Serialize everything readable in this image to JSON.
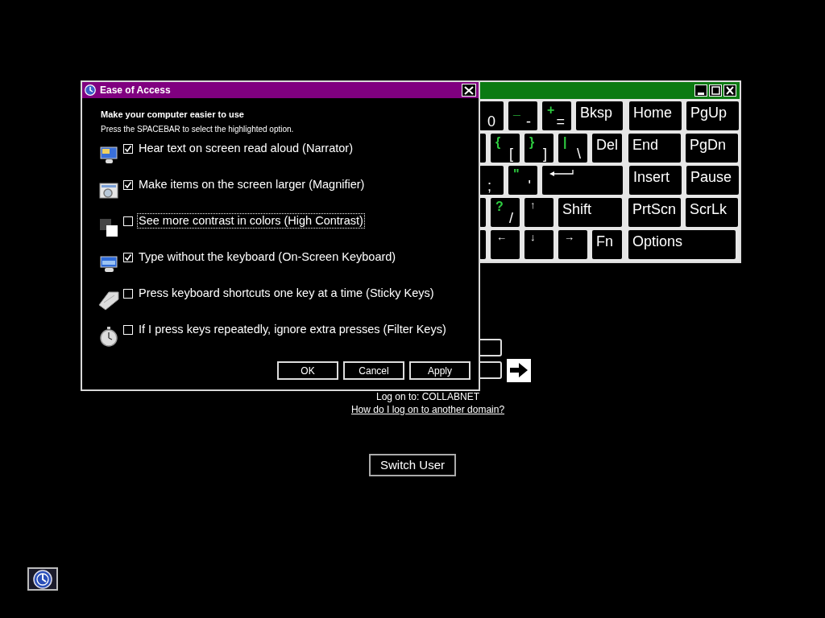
{
  "keyboard": {
    "rows": [
      {
        "keys": [
          {
            "kind": "partial",
            "main": "0"
          },
          {
            "kind": "char",
            "shift": "_",
            "main": "-"
          },
          {
            "kind": "char",
            "shift": "+",
            "main": "="
          },
          {
            "kind": "label",
            "main": "Bksp"
          },
          {
            "kind": "label",
            "main": "Home"
          },
          {
            "kind": "label",
            "main": "PgUp"
          }
        ]
      },
      {
        "keys": [
          {
            "kind": "partial"
          },
          {
            "kind": "char",
            "shift": "{",
            "main": "["
          },
          {
            "kind": "char",
            "shift": "}",
            "main": "]"
          },
          {
            "kind": "char",
            "shift": "|",
            "main": "\\"
          },
          {
            "kind": "label",
            "main": "Del"
          },
          {
            "kind": "label",
            "main": "End"
          },
          {
            "kind": "label",
            "main": "PgDn"
          }
        ]
      },
      {
        "keys": [
          {
            "kind": "partial",
            "main": ";"
          },
          {
            "kind": "char",
            "shift": "\"",
            "main": "'"
          },
          {
            "kind": "enter"
          },
          {
            "kind": "label",
            "main": "Insert"
          },
          {
            "kind": "label",
            "main": "Pause"
          }
        ]
      },
      {
        "keys": [
          {
            "kind": "partial"
          },
          {
            "kind": "char",
            "shift": "?",
            "main": "/"
          },
          {
            "kind": "arrow",
            "main": "↑"
          },
          {
            "kind": "label",
            "main": "Shift"
          },
          {
            "kind": "label",
            "main": "PrtScn"
          },
          {
            "kind": "label",
            "main": "ScrLk"
          }
        ]
      },
      {
        "keys": [
          {
            "kind": "partial"
          },
          {
            "kind": "arrow",
            "main": "←"
          },
          {
            "kind": "arrow",
            "main": "↓"
          },
          {
            "kind": "arrow",
            "main": "→"
          },
          {
            "kind": "label",
            "main": "Fn"
          },
          {
            "kind": "label",
            "main": "Options"
          }
        ]
      }
    ]
  },
  "login": {
    "domain_text": "Log on to: COLLABNET",
    "help_link": "How do I log on to another domain?",
    "switch_user": "Switch User"
  },
  "dialog": {
    "title": "Ease of Access",
    "heading": "Make your computer easier to use",
    "instruction": "Press the SPACEBAR to select the highlighted option.",
    "options": [
      {
        "label": "Hear text on screen read aloud (Narrator)",
        "checked": true,
        "focused": false
      },
      {
        "label": "Make items on the screen larger (Magnifier)",
        "checked": true,
        "focused": false
      },
      {
        "label": "See more contrast in colors (High Contrast)",
        "checked": false,
        "focused": true
      },
      {
        "label": "Type without the keyboard (On-Screen Keyboard)",
        "checked": true,
        "focused": false
      },
      {
        "label": "Press keyboard shortcuts one key at a time (Sticky Keys)",
        "checked": false,
        "focused": false
      },
      {
        "label": "If I press keys repeatedly, ignore extra presses (Filter Keys)",
        "checked": false,
        "focused": false
      }
    ],
    "buttons": [
      "OK",
      "Cancel",
      "Apply"
    ]
  }
}
